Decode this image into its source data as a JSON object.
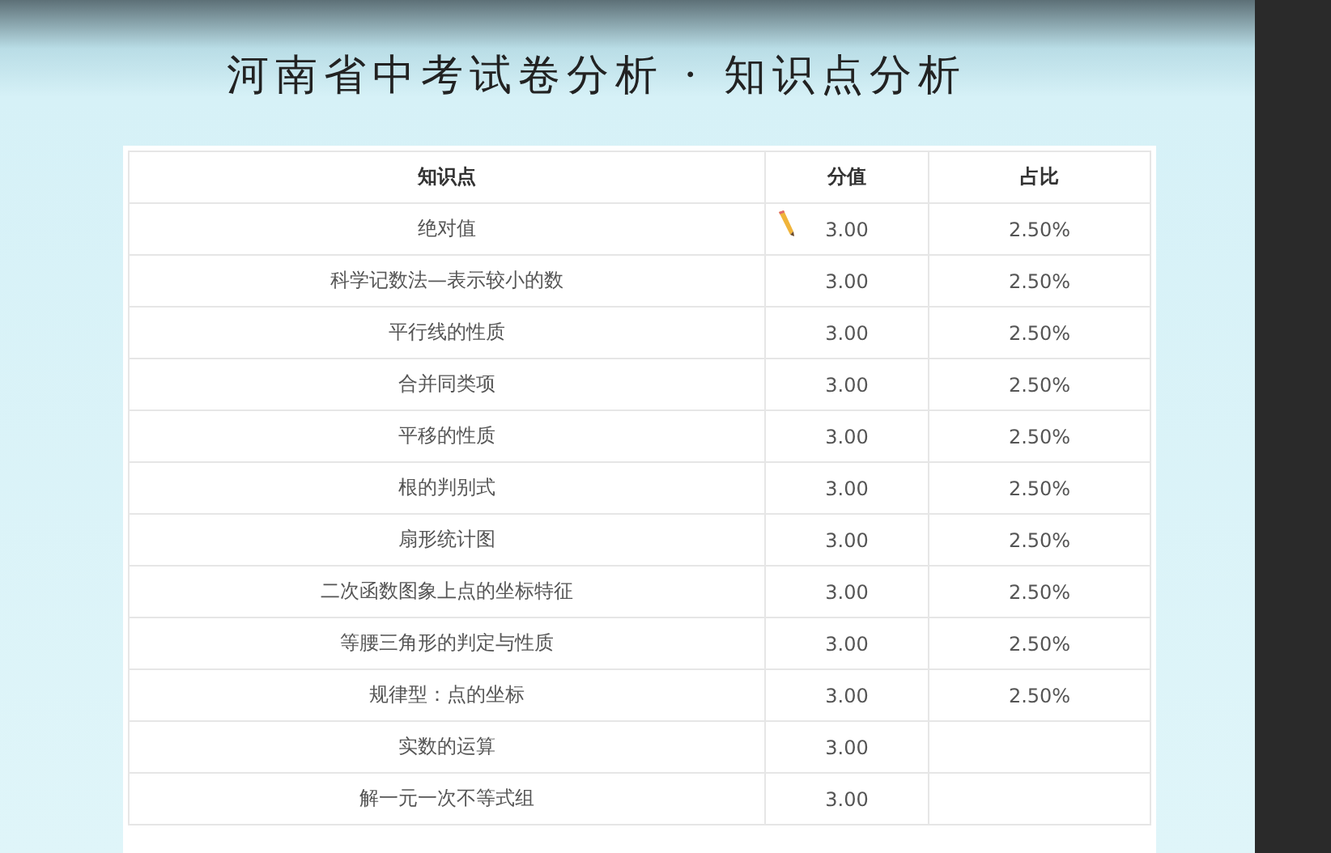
{
  "slide": {
    "title": "河南省中考试卷分析 · 知识点分析"
  },
  "table": {
    "columns": [
      "知识点",
      "分值",
      "占比"
    ],
    "rows": [
      {
        "topic": "绝对值",
        "score": "3.00",
        "share": "2.50%"
      },
      {
        "topic": "科学记数法—表示较小的数",
        "score": "3.00",
        "share": "2.50%"
      },
      {
        "topic": "平行线的性质",
        "score": "3.00",
        "share": "2.50%"
      },
      {
        "topic": "合并同类项",
        "score": "3.00",
        "share": "2.50%"
      },
      {
        "topic": "平移的性质",
        "score": "3.00",
        "share": "2.50%"
      },
      {
        "topic": "根的判别式",
        "score": "3.00",
        "share": "2.50%"
      },
      {
        "topic": "扇形统计图",
        "score": "3.00",
        "share": "2.50%"
      },
      {
        "topic": "二次函数图象上点的坐标特征",
        "score": "3.00",
        "share": "2.50%"
      },
      {
        "topic": "等腰三角形的判定与性质",
        "score": "3.00",
        "share": "2.50%"
      },
      {
        "topic": "规律型：点的坐标",
        "score": "3.00",
        "share": "2.50%"
      },
      {
        "topic": "实数的运算",
        "score": "3.00"
      },
      {
        "topic": "解一元一次不等式组",
        "score": "3.00"
      }
    ]
  }
}
